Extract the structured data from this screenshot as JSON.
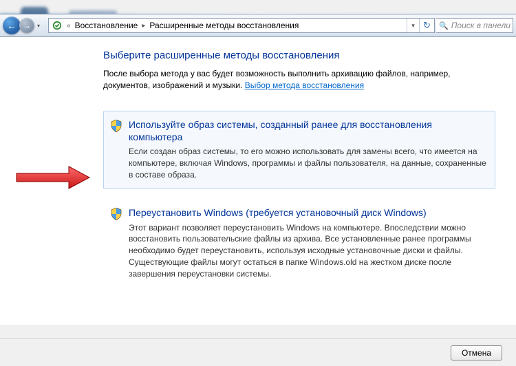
{
  "nav": {
    "back_glyph": "←",
    "forward_glyph": "→",
    "history_glyph": "▾"
  },
  "address": {
    "prev_glyph": "«",
    "seg1": "Восстановление",
    "arrow": "▸",
    "seg2": "Расширенные методы восстановления",
    "dropdown_glyph": "▾",
    "refresh_glyph": "↻"
  },
  "search": {
    "placeholder": "Поиск в панели упра",
    "icon": "🔍"
  },
  "page": {
    "heading": "Выберите расширенные методы восстановления",
    "intro_text": "После выбора метода у вас будет возможность выполнить архивацию файлов, например, документов, изображений и музыки. ",
    "intro_link": "Выбор метода восстановления"
  },
  "options": [
    {
      "title": "Используйте образ системы, созданный ранее для восстановления компьютера",
      "desc": "Если создан образ системы, то его можно использовать для замены всего, что имеется на компьютере, включая Windows, программы и файлы пользователя, на данные, сохраненные в составе образа."
    },
    {
      "title": "Переустановить Windows (требуется установочный диск Windows)",
      "desc": "Этот вариант позволяет переустановить Windows на компьютере. Впоследствии можно восстановить пользовательские файлы из архива. Все установленные ранее программы необходимо будет переустановить, используя исходные установочные диски и файлы. Существующие файлы могут остаться в папке Windows.old на жестком диске после завершения переустановки системы."
    }
  ],
  "buttons": {
    "cancel": "Отмена"
  }
}
